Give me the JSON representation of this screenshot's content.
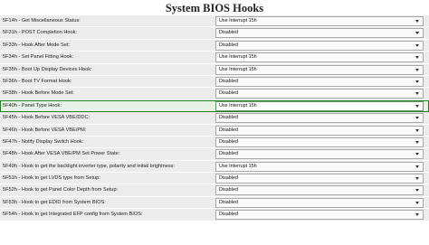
{
  "page": {
    "title": "System BIOS Hooks"
  },
  "hooks": [
    {
      "label": "5F14h - Get Miscellaneous Status:",
      "value": "Use Interrupt 15h"
    },
    {
      "label": "5F31h - POST Completion Hook:",
      "value": "Disabled"
    },
    {
      "label": "5F33h - Hook After Mode Set:",
      "value": "Disabled"
    },
    {
      "label": "5F34h - Set Panel Fitting Hook:",
      "value": "Use Interrupt 15h"
    },
    {
      "label": "5F35h - Boot Up Display Devices Hook:",
      "value": "Use Interrupt 15h"
    },
    {
      "label": "5F36h - Boot TV Format Hook:",
      "value": "Disabled"
    },
    {
      "label": "5F38h - Hook Before Mode Set:",
      "value": "Disabled"
    },
    {
      "label": "5F40h - Panel Type Hook:",
      "value": "Use Interrupt 15h"
    },
    {
      "label": "5F45h - Hook Before VESA VBE/DDC:",
      "value": "Disabled"
    },
    {
      "label": "5F46h - Hook Before VESA VBE/PM:",
      "value": "Disabled"
    },
    {
      "label": "5F47h - Notify Display Switch Hook:",
      "value": "Disabled"
    },
    {
      "label": "5F48h - Hook After VESA VBE/PM Set Power State:",
      "value": "Disabled"
    },
    {
      "label": "5F49h - Hook to get the backlight inverter type, polarity and initial brightness:",
      "value": "Use Interrupt 15h"
    },
    {
      "label": "5F51h - Hook to get LVDS type from Setup:",
      "value": "Disabled"
    },
    {
      "label": "5F52h - Hook to get Panel Color Depth from Setup:",
      "value": "Disabled"
    },
    {
      "label": "5F53h - Hook to get EDID from System BIOS:",
      "value": "Disabled"
    },
    {
      "label": "5F54h - Hook to get Integrated EFP config from System BIOS:",
      "value": "Disabled"
    }
  ],
  "selected_index": 7,
  "colors": {
    "row_bg": "#ececec",
    "selected_row_bg": "#e6f2e6",
    "selected_outline": "#2a7a2a"
  },
  "icons": {
    "dropdown": "chevron-down-icon"
  }
}
